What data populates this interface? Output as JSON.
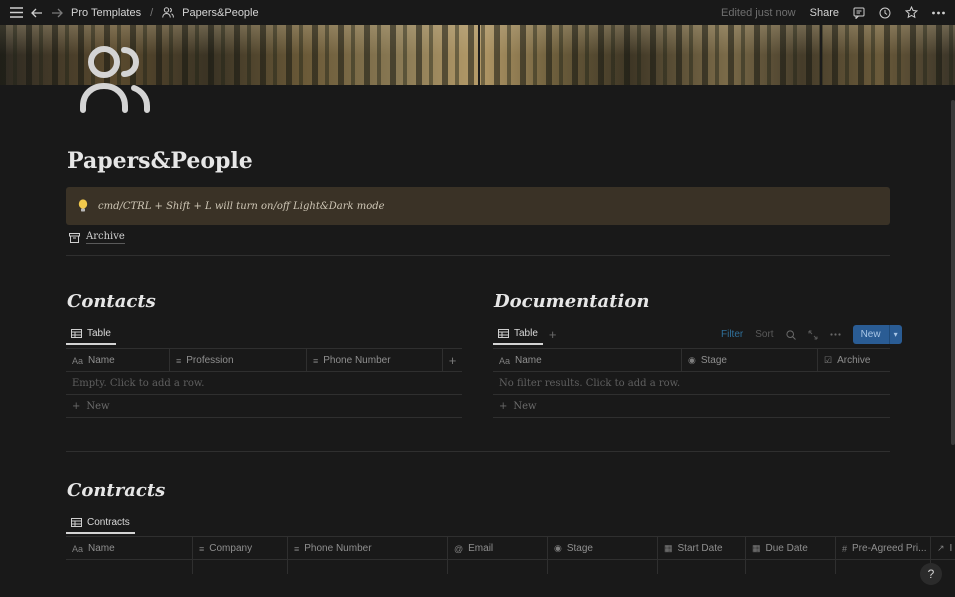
{
  "topbar": {
    "crumb_parent": "Pro Templates",
    "crumb_sep": "/",
    "crumb_current": "Papers&People",
    "edited": "Edited just now",
    "share": "Share"
  },
  "page": {
    "title": "Papers&People",
    "callout_text": "cmd/CTRL + Shift + L will turn on/off Light&Dark mode",
    "archive_label": "Archive"
  },
  "contacts": {
    "heading": "Contacts",
    "tab": "Table",
    "columns": [
      {
        "icon": "Aa",
        "label": "Name"
      },
      {
        "icon": "≡",
        "label": "Profession"
      },
      {
        "icon": "≡",
        "label": "Phone Number"
      }
    ],
    "empty": "Empty. Click to add a row.",
    "new_label": "New"
  },
  "documentation": {
    "heading": "Documentation",
    "tab": "Table",
    "filter": "Filter",
    "sort": "Sort",
    "new_button": "New",
    "columns": [
      {
        "icon": "Aa",
        "label": "Name"
      },
      {
        "icon": "◉",
        "label": "Stage"
      },
      {
        "icon": "☑",
        "label": "Archive"
      }
    ],
    "empty": "No filter results. Click to add a row.",
    "new_label": "New"
  },
  "contracts": {
    "heading": "Contracts",
    "tab": "Contracts",
    "columns": [
      {
        "icon": "Aa",
        "label": "Name"
      },
      {
        "icon": "≡",
        "label": "Company"
      },
      {
        "icon": "≡",
        "label": "Phone Number"
      },
      {
        "icon": "@",
        "label": "Email"
      },
      {
        "icon": "◉",
        "label": "Stage"
      },
      {
        "icon": "▦",
        "label": "Start Date"
      },
      {
        "icon": "▦",
        "label": "Due Date"
      },
      {
        "icon": "#",
        "label": "Pre-Agreed Pri..."
      },
      {
        "icon": "↗",
        "label": "I"
      }
    ]
  },
  "help": "?",
  "colors": {
    "background": "#191919",
    "callout": "#3a3226",
    "accent_blue": "#2a5c94"
  }
}
